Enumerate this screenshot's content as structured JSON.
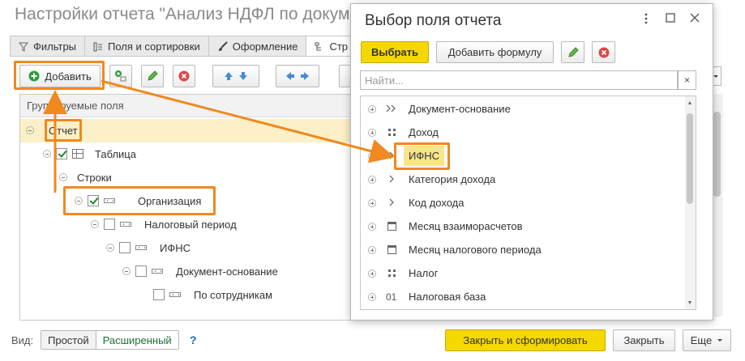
{
  "window": {
    "title": "Настройки отчета \"Анализ НДФЛ по документам"
  },
  "tabs": [
    {
      "label": "Фильтры",
      "icon": "filter-icon"
    },
    {
      "label": "Поля и сортировки",
      "icon": "fields-icon"
    },
    {
      "label": "Оформление",
      "icon": "brush-icon"
    },
    {
      "label": "Стр",
      "icon": "structure-icon"
    }
  ],
  "toolbar": {
    "add_label": "Добавить"
  },
  "tree": {
    "header": "Группируемые поля",
    "rows": [
      {
        "label": "Отчет",
        "checked": null
      },
      {
        "label": "Таблица",
        "checked": true
      },
      {
        "label": "Строки",
        "checked": null
      },
      {
        "label": "Организация",
        "checked": true
      },
      {
        "label": "Налоговый период",
        "checked": false
      },
      {
        "label": "ИФНС",
        "checked": false
      },
      {
        "label": "Документ-основание",
        "checked": false
      },
      {
        "label": "По сотрудникам",
        "checked": false
      }
    ]
  },
  "footer": {
    "view_label": "Вид:",
    "simple": "Простой",
    "extended": "Расширенный",
    "help": "?",
    "generate": "Закрыть и сформировать",
    "close": "Закрыть",
    "more": "Еще"
  },
  "dialog": {
    "title": "Выбор поля отчета",
    "select_button": "Выбрать",
    "add_formula_button": "Добавить формулу",
    "search_placeholder": "Найти...",
    "clear_label": "×",
    "items": [
      {
        "label": "Документ-основание",
        "icon": "double-chevron-icon"
      },
      {
        "label": "Доход",
        "icon": "grid-icon"
      },
      {
        "label": "ИФНС",
        "icon": "chevron-right-icon"
      },
      {
        "label": "Категория дохода",
        "icon": "chevron-right-icon"
      },
      {
        "label": "Код дохода",
        "icon": "chevron-right-icon"
      },
      {
        "label": "Месяц взаиморасчетов",
        "icon": "calendar-icon"
      },
      {
        "label": "Месяц налогового периода",
        "icon": "calendar-icon"
      },
      {
        "label": "Налог",
        "icon": "grid-icon"
      },
      {
        "label": "Налоговая база",
        "icon": "number-icon"
      }
    ]
  },
  "colors": {
    "accent_yellow": "#f5d800",
    "highlight_orange": "#f0891f",
    "row_highlight": "#fbf0c7"
  }
}
